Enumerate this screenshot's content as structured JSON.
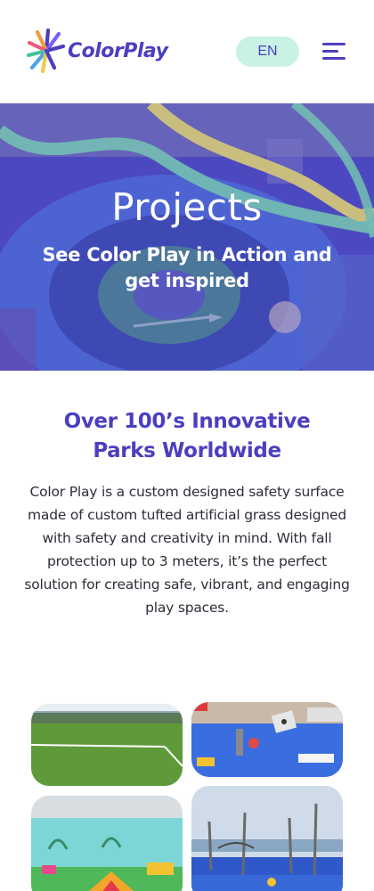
{
  "header": {
    "logo_text": "ColorPlay",
    "logo_icon": "color-burst-icon",
    "language_label": "EN",
    "menu_icon": "hamburger-menu-icon"
  },
  "hero": {
    "title": "Projects",
    "subtitle": "See Color Play in Action and get inspired"
  },
  "intro": {
    "title": "Over 100’s Innovative Parks Worldwide",
    "body": "Color Play is a custom designed safety surface made of custom tufted artificial grass designed with safety and creativity in mind. With fall protection up to 3 meters, it’s the perfect solution for creating safe, vibrant, and engaging play spaces."
  },
  "gallery": {
    "images": [
      "soccer-field-photo",
      "blue-playground-photo",
      "colorful-indoor-playground-photo",
      "seaside-playground-photo"
    ]
  },
  "colors": {
    "brand_purple": "#4b3fbf",
    "mint": "#c9f2e4",
    "hero_overlay": "#5a58c8",
    "accent_yellow": "#f5e86a",
    "accent_green": "#7fe3b0"
  }
}
